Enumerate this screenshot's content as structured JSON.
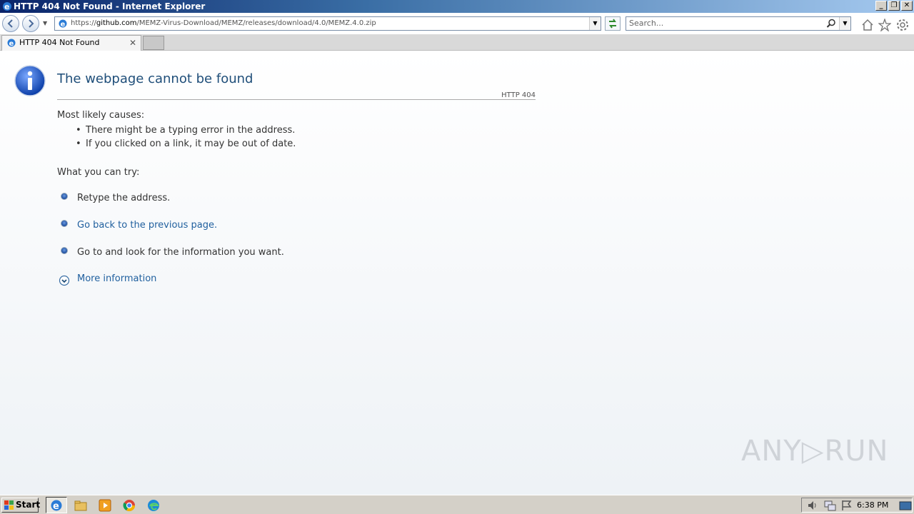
{
  "window": {
    "title": "HTTP 404 Not Found - Internet Explorer",
    "minimize": "_",
    "restore": "❐",
    "close": "✕"
  },
  "navbar": {
    "url_scheme": "https://",
    "url_host": "github.com",
    "url_path": "/MEMZ-Virus-Download/MEMZ/releases/download/4.0/MEMZ.4.0.zip",
    "search_placeholder": "Search..."
  },
  "tab": {
    "label": "HTTP 404 Not Found",
    "close": "✕"
  },
  "page": {
    "title": "The webpage cannot be found",
    "http_code": "HTTP 404",
    "causes_heading": "Most likely causes:",
    "causes": [
      "There might be a typing error in the address.",
      "If you clicked on a link, it may be out of date."
    ],
    "try_heading": "What you can try:",
    "try_items": [
      "Retype the address.",
      "Go back to the previous page.",
      "Go to  and look for the information you want."
    ],
    "more_info": "More information"
  },
  "watermark": "ANY▷RUN",
  "taskbar": {
    "start_label": "Start",
    "clock": "6:38 PM"
  }
}
